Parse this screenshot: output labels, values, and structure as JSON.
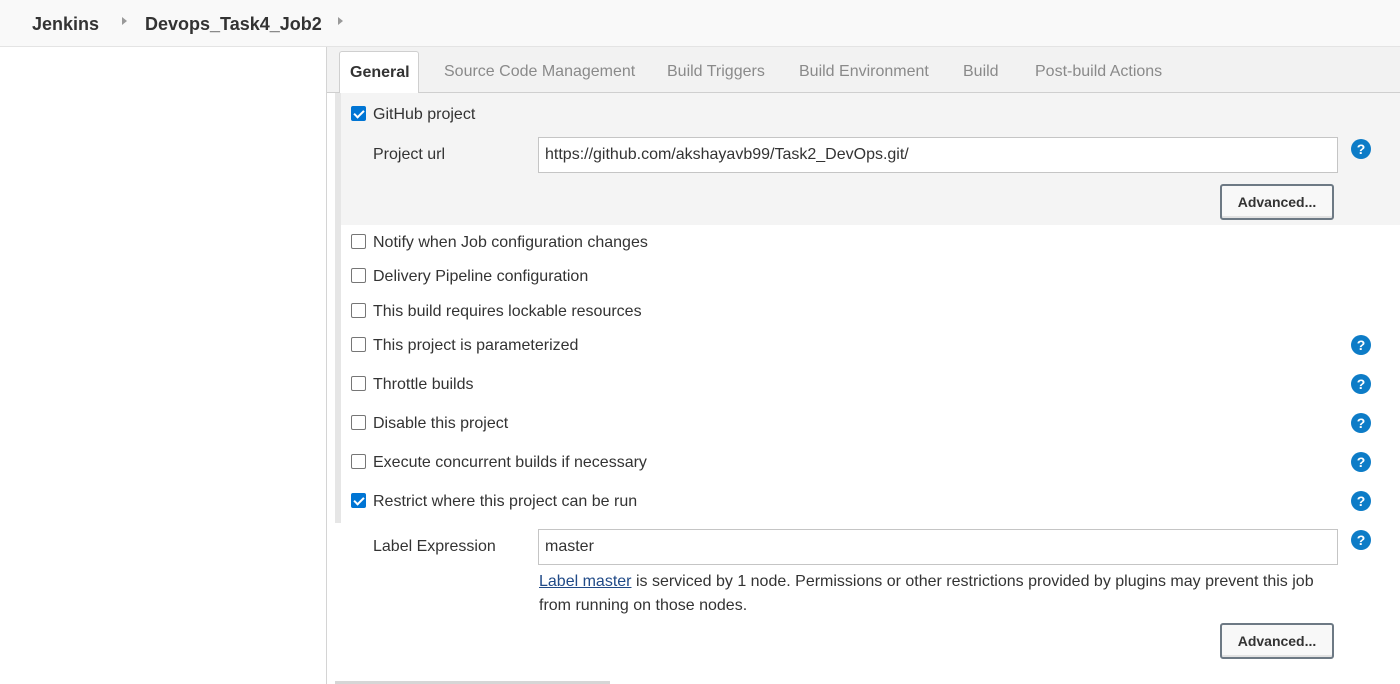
{
  "breadcrumb": {
    "items": [
      "Jenkins",
      "Devops_Task4_Job2"
    ]
  },
  "tabs": [
    {
      "label": "General",
      "active": true
    },
    {
      "label": "Source Code Management",
      "active": false
    },
    {
      "label": "Build Triggers",
      "active": false
    },
    {
      "label": "Build Environment",
      "active": false
    },
    {
      "label": "Build",
      "active": false
    },
    {
      "label": "Post-build Actions",
      "active": false
    }
  ],
  "github_project": {
    "label": "GitHub project",
    "checked": true,
    "project_url_label": "Project url",
    "project_url_value": "https://github.com/akshayavb99/Task2_DevOps.git/",
    "advanced_label": "Advanced..."
  },
  "options": [
    {
      "label": "Notify when Job configuration changes",
      "checked": false
    },
    {
      "label": "Delivery Pipeline configuration",
      "checked": false
    },
    {
      "label": "This build requires lockable resources",
      "checked": false
    },
    {
      "label": "This project is parameterized",
      "checked": false
    },
    {
      "label": "Throttle builds",
      "checked": false
    },
    {
      "label": "Disable this project",
      "checked": false
    },
    {
      "label": "Execute concurrent builds if necessary",
      "checked": false
    },
    {
      "label": "Restrict where this project can be run",
      "checked": true
    }
  ],
  "restrict": {
    "label_expression_label": "Label Expression",
    "label_expression_value": "master",
    "info_link": "Label master",
    "info_text_line1": " is serviced by 1 node. Permissions or other restrictions provided by plugins may prevent this job",
    "info_text_line2": "from running on those nodes.",
    "advanced_label": "Advanced..."
  },
  "help_glyph": "?",
  "colors": {
    "checkbox_checked": "#0075d4",
    "help_icon": "#0d7cc7",
    "link": "#204a87"
  }
}
